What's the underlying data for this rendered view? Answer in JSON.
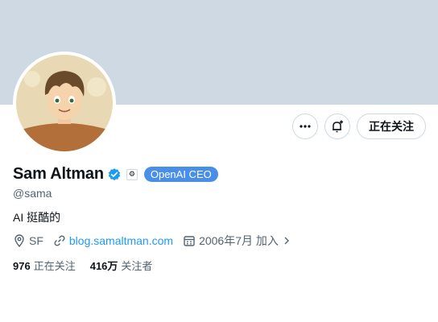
{
  "profile": {
    "name": "Sam Altman",
    "handle": "@sama",
    "affiliation_icon": "openai-logo-icon",
    "affiliation_label": "OpenAI CEO",
    "bio": "AI 挺酷的",
    "location": "SF",
    "website": "blog.samaltman.com",
    "joined": "2006年7月 加入"
  },
  "actions": {
    "more_icon": "more-dots-icon",
    "notify_icon": "bell-plus-icon",
    "follow_label": "正在关注"
  },
  "stats": {
    "following_count": "976",
    "following_label": "正在关注",
    "followers_count": "416万",
    "followers_label": "关注者"
  },
  "colors": {
    "banner": "#cfd9e3",
    "accent": "#1d9bf0",
    "badge": "#4a8fe7",
    "muted_text": "#536471"
  }
}
